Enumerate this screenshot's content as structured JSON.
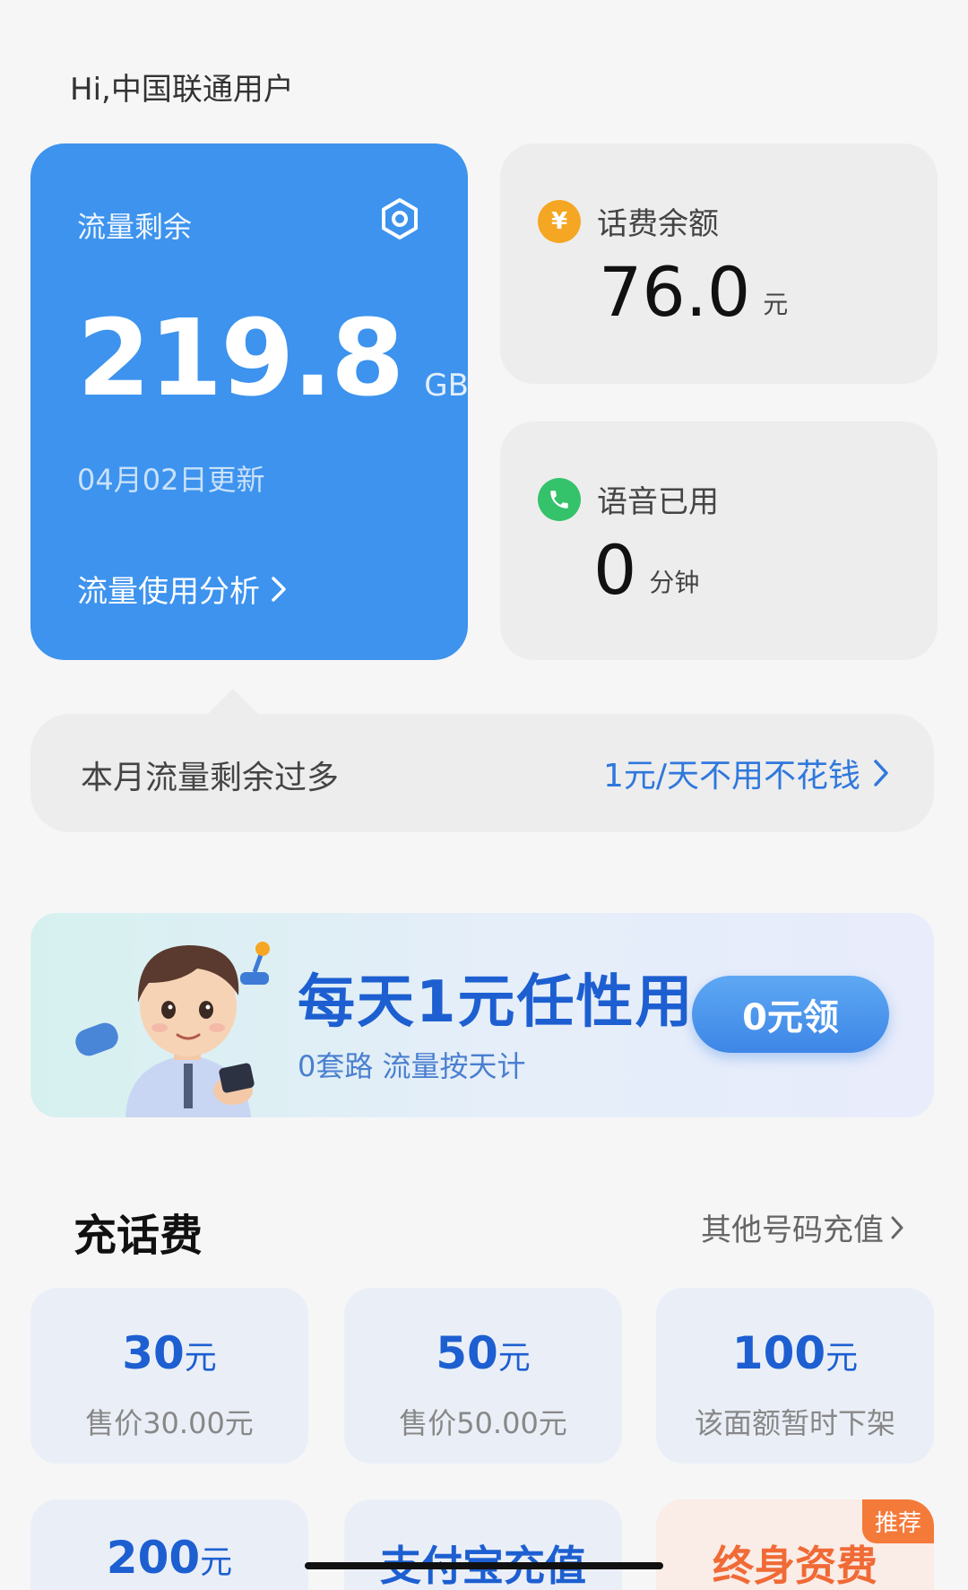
{
  "greeting": "Hi,中国联通用户",
  "data_card": {
    "title": "流量剩余",
    "value": "219.8",
    "unit": "GB",
    "updated": "04月02日更新",
    "analysis_link": "流量使用分析"
  },
  "balance_card": {
    "icon": "yen-icon",
    "label": "话费余额",
    "value": "76.0",
    "unit": "元"
  },
  "voice_card": {
    "icon": "phone-icon",
    "label": "语音已用",
    "value": "0",
    "unit": "分钟"
  },
  "tip": {
    "message": "本月流量剩余过多",
    "action": "1元/天不用不花钱"
  },
  "banner": {
    "headline": "每天1元任性用",
    "subtitle": "0套路 流量按天计",
    "button": "0元领"
  },
  "recharge": {
    "title": "充话费",
    "other_link": "其他号码充值",
    "tiles": [
      {
        "amount": "30",
        "unit": "元",
        "price": "售价30.00元"
      },
      {
        "amount": "50",
        "unit": "元",
        "price": "售价50.00元"
      },
      {
        "amount": "100",
        "unit": "元",
        "price": "该面额暂时下架"
      }
    ],
    "row2": [
      {
        "amount": "200",
        "unit": "元"
      },
      {
        "label": "支付宝充值"
      },
      {
        "label": "终身资费",
        "badge": "推荐"
      }
    ]
  },
  "colors": {
    "primary_blue": "#3d93ee",
    "link_blue": "#2f78dc",
    "coin_orange": "#f5a623",
    "phone_green": "#34c26a",
    "recommend_orange": "#f47a3a"
  }
}
